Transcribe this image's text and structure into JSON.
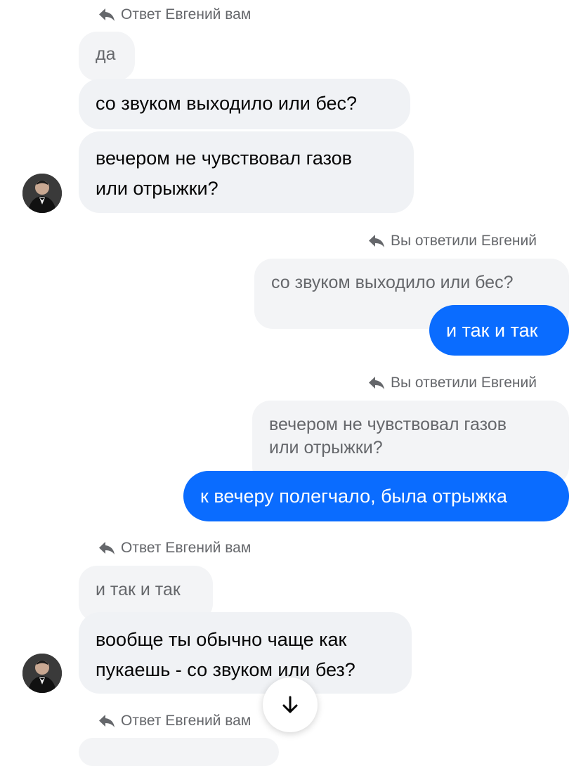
{
  "messages": {
    "reply_from_evgeniy": "Ответ Евгений вам",
    "reply_from_you": "Вы ответили Евгений",
    "block1": {
      "quoted": "да",
      "bubble1": "со звуком выходило или бес?",
      "bubble2_line1": "вечером не чувствовал газов",
      "bubble2_line2": "или отрыжки?"
    },
    "block2": {
      "quoted": "со звуком выходило или бес?",
      "reply": "и так и так"
    },
    "block3": {
      "quoted_line1": "вечером не чувствовал газов",
      "quoted_line2": "или отрыжки?",
      "reply": "к вечеру полегчало, была отрыжка"
    },
    "block4": {
      "quoted": "и так и так",
      "bubble_line1": "вообще ты обычно чаще как",
      "bubble_line2": "пукаешь - со звуком или без?"
    }
  },
  "icons": {
    "reply": "reply-arrow-icon",
    "scroll_down": "arrow-down-icon"
  },
  "colors": {
    "outgoing_bubble": "#0a6cff",
    "incoming_bubble": "#f0f2f5",
    "quoted_bubble": "#f3f4f6",
    "meta_text": "#65676b"
  }
}
